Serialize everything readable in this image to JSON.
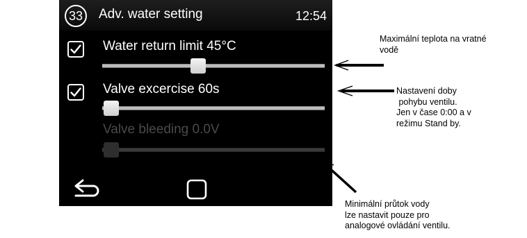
{
  "header": {
    "badge": "33",
    "title": "Adv. water setting",
    "time": "12:54"
  },
  "settings": [
    {
      "label": "Water return limit 45°C",
      "checked": true,
      "enabled": true,
      "value_fraction": 0.43
    },
    {
      "label": "Valve excercise 60s",
      "checked": true,
      "enabled": true,
      "value_fraction": 0.04
    },
    {
      "label": "Valve bleeding 0.0V",
      "checked": false,
      "enabled": false,
      "value_fraction": 0.04
    }
  ],
  "bottom_bar": {
    "back_icon": "back-arrow-icon",
    "home_icon": "home-square-icon"
  },
  "annotations": {
    "water_return": [
      "Maximální teplota na vratné",
      "vodě"
    ],
    "valve_excercise": [
      "Nastavení doby",
      " pohybu ventilu.",
      "Jen v čase 0:00 a v",
      "režimu Stand by."
    ],
    "valve_bleeding": [
      "Minimální průtok vody",
      "lze nastavit pouze pro",
      "analogové ovládání ventilu."
    ]
  },
  "colors": {
    "screen_bg": "#000000",
    "text": "#ffffff",
    "disabled_text": "#4a4a4a",
    "annotation_text": "#000000"
  }
}
